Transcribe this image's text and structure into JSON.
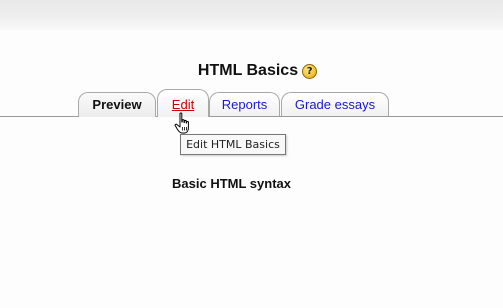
{
  "page": {
    "title": "HTML Basics",
    "help_icon": "question-mark-icon",
    "section_heading": "Basic HTML syntax"
  },
  "tabs": [
    {
      "label": "Preview",
      "state": "selected"
    },
    {
      "label": "Edit",
      "state": "hover"
    },
    {
      "label": "Reports",
      "state": "normal"
    },
    {
      "label": "Grade essays",
      "state": "normal"
    }
  ],
  "tooltip": {
    "text": "Edit HTML Basics"
  },
  "cursor": {
    "icon": "hand-pointer-icon"
  },
  "colors": {
    "link": "#1a1acc",
    "hover_link": "#cc0000",
    "tab_border": "#a8a8a8"
  }
}
